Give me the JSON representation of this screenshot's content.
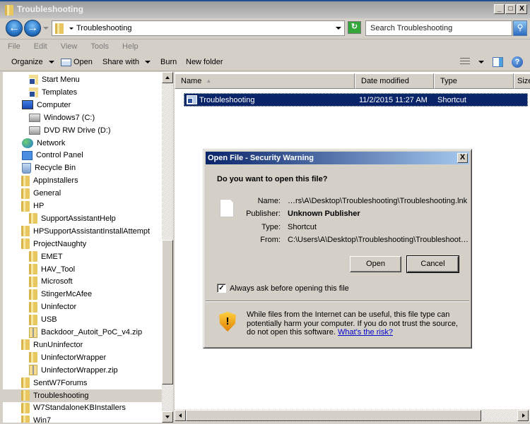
{
  "window": {
    "title": "Troubleshooting",
    "controls": {
      "minimize": "_",
      "maximize": "□",
      "close": "X"
    }
  },
  "address_bar": {
    "back_icon": "back-arrow-icon",
    "forward_icon": "forward-arrow-icon",
    "path": "Troubleshooting",
    "search_placeholder": "Search Troubleshooting",
    "refresh_icon": "refresh-icon",
    "search_icon": "search-icon"
  },
  "menu": [
    "File",
    "Edit",
    "View",
    "Tools",
    "Help"
  ],
  "command_bar": {
    "organize": "Organize",
    "open": "Open",
    "share_with": "Share with",
    "burn": "Burn",
    "new_folder": "New folder"
  },
  "nav_tree": [
    {
      "label": "Start Menu",
      "icon": "shortcut-folder",
      "level": 2
    },
    {
      "label": "Templates",
      "icon": "shortcut-folder",
      "level": 2
    },
    {
      "label": "Computer",
      "icon": "computer",
      "level": 1
    },
    {
      "label": "Windows7 (C:)",
      "icon": "drive",
      "level": 2
    },
    {
      "label": "DVD RW Drive (D:)",
      "icon": "drive",
      "level": 2
    },
    {
      "label": "Network",
      "icon": "network",
      "level": 1
    },
    {
      "label": "Control Panel",
      "icon": "control-panel",
      "level": 1
    },
    {
      "label": "Recycle Bin",
      "icon": "recycle-bin",
      "level": 1
    },
    {
      "label": "AppInstallers",
      "icon": "folder",
      "level": 1
    },
    {
      "label": "General",
      "icon": "folder",
      "level": 1
    },
    {
      "label": "HP",
      "icon": "folder",
      "level": 1
    },
    {
      "label": "SupportAssistantHelp",
      "icon": "folder",
      "level": 2
    },
    {
      "label": "HPSupportAssistantInstallAttempt",
      "icon": "folder",
      "level": 1
    },
    {
      "label": "ProjectNaughty",
      "icon": "folder",
      "level": 1
    },
    {
      "label": "EMET",
      "icon": "folder",
      "level": 2
    },
    {
      "label": "HAV_Tool",
      "icon": "folder",
      "level": 2
    },
    {
      "label": "Microsoft",
      "icon": "folder",
      "level": 2
    },
    {
      "label": "StingerMcAfee",
      "icon": "folder",
      "level": 2
    },
    {
      "label": "Uninfector",
      "icon": "folder",
      "level": 2
    },
    {
      "label": "USB",
      "icon": "folder",
      "level": 2
    },
    {
      "label": "Backdoor_Autoit_PoC_v4.zip",
      "icon": "zip",
      "level": 2
    },
    {
      "label": "RunUninfector",
      "icon": "folder",
      "level": 1
    },
    {
      "label": "UninfectorWrapper",
      "icon": "folder",
      "level": 2
    },
    {
      "label": "UninfectorWrapper.zip",
      "icon": "zip",
      "level": 2
    },
    {
      "label": "SentW7Forums",
      "icon": "folder",
      "level": 1
    },
    {
      "label": "Troubleshooting",
      "icon": "folder",
      "level": 1,
      "selected": true
    },
    {
      "label": "W7StandaloneKBInstallers",
      "icon": "folder",
      "level": 1
    },
    {
      "label": "Win7",
      "icon": "folder",
      "level": 1
    }
  ],
  "file_list": {
    "columns": [
      "Name",
      "Date modified",
      "Type",
      "Size"
    ],
    "sort_indicator": "▲",
    "rows": [
      {
        "name": "Troubleshooting",
        "date_modified": "11/2/2015 11:27 AM",
        "type": "Shortcut",
        "size": ""
      }
    ]
  },
  "dialog": {
    "title": "Open File - Security Warning",
    "close": "X",
    "question": "Do you want to open this file?",
    "fields": [
      {
        "label": "Name:",
        "value": "…rs\\A\\Desktop\\Troubleshooting\\Troubleshooting.lnk",
        "bold": false
      },
      {
        "label": "Publisher:",
        "value": "Unknown Publisher",
        "bold": true
      },
      {
        "label": "Type:",
        "value": "Shortcut",
        "bold": false
      },
      {
        "label": "From:",
        "value": "C:\\Users\\A\\Desktop\\Troubleshooting\\Troubleshoot…",
        "bold": false
      }
    ],
    "open_button": "Open",
    "cancel_button": "Cancel",
    "checkbox_label": "Always ask before opening this file",
    "checkbox_checked": true,
    "warning_text": "While files from the Internet can be useful, this file type can potentially harm your computer. If you do not trust the source, do not open this software.",
    "risk_link": "What's the risk?"
  }
}
